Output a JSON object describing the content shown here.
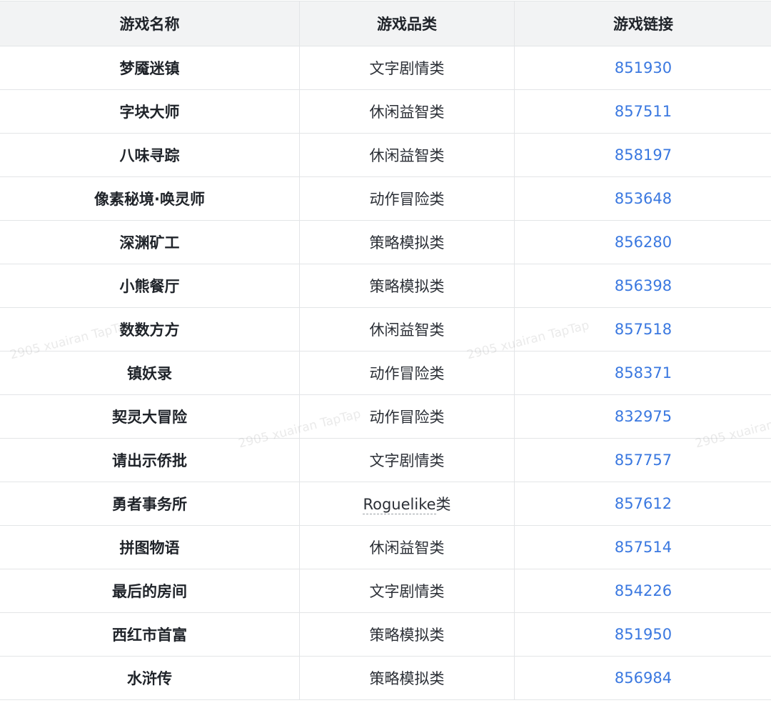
{
  "table": {
    "headers": {
      "name": "游戏名称",
      "category": "游戏品类",
      "link": "游戏链接"
    },
    "rows": [
      {
        "name": "梦魇迷镇",
        "category": "文字剧情类",
        "link": "851930"
      },
      {
        "name": "字块大师",
        "category": "休闲益智类",
        "link": "857511"
      },
      {
        "name": "八味寻踪",
        "category": "休闲益智类",
        "link": "858197"
      },
      {
        "name": "像素秘境·唤灵师",
        "category": "动作冒险类",
        "link": "853648"
      },
      {
        "name": "深渊矿工",
        "category": "策略模拟类",
        "link": "856280"
      },
      {
        "name": "小熊餐厅",
        "category": "策略模拟类",
        "link": "856398"
      },
      {
        "name": "数数方方",
        "category": "休闲益智类",
        "link": "857518"
      },
      {
        "name": "镇妖录",
        "category": "动作冒险类",
        "link": "858371"
      },
      {
        "name": "契灵大冒险",
        "category": "动作冒险类",
        "link": "832975"
      },
      {
        "name": "请出示侨批",
        "category": "文字剧情类",
        "link": "857757"
      },
      {
        "name": "勇者事务所",
        "category": "Roguelike类",
        "link": "857612"
      },
      {
        "name": "拼图物语",
        "category": "休闲益智类",
        "link": "857514"
      },
      {
        "name": "最后的房间",
        "category": "文字剧情类",
        "link": "854226"
      },
      {
        "name": "西红市首富",
        "category": "策略模拟类",
        "link": "851950"
      },
      {
        "name": "水浒传",
        "category": "策略模拟类",
        "link": "856984"
      }
    ]
  },
  "watermark": {
    "text": "2905 xuairan TapTap"
  },
  "colors": {
    "header_bg": "#f2f3f4",
    "border": "#e3e5e7",
    "link": "#3a78e0",
    "text": "#1f2329"
  }
}
